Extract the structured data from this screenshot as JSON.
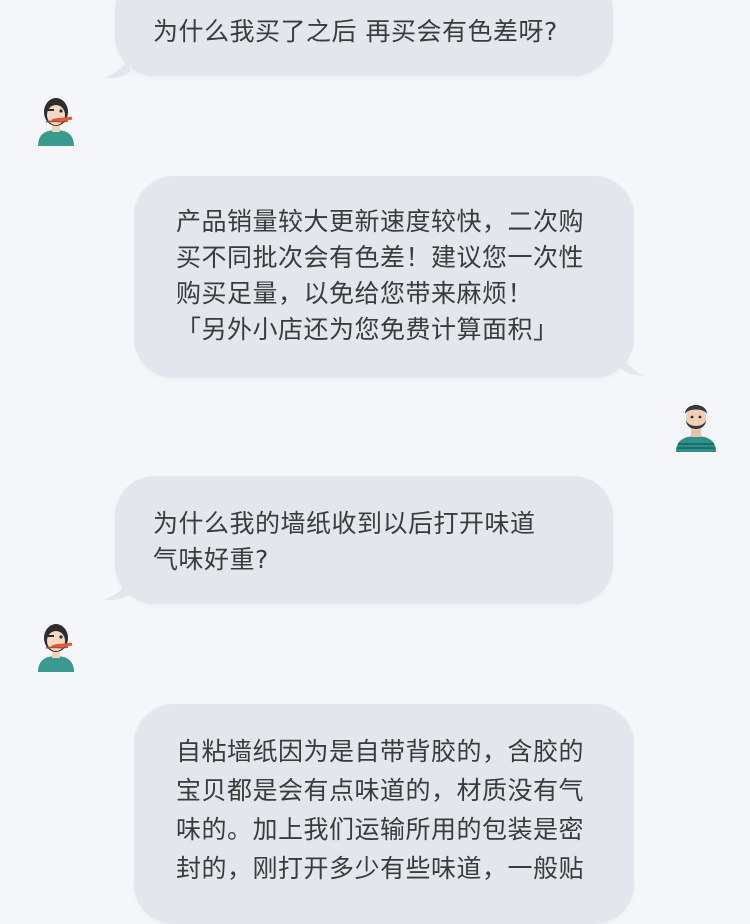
{
  "messages": [
    {
      "role": "customer",
      "lines": [
        "为什么我买了之后 再买会有色差呀?"
      ]
    },
    {
      "role": "seller",
      "lines": [
        "产品销量较大更新速度较快，二次购",
        "买不同批次会有色差！建议您一次性",
        "购买足量，以免给您带来麻烦！",
        "「另外小店还为您免费计算面积」"
      ]
    },
    {
      "role": "customer",
      "lines": [
        "为什么我的墙纸收到以后打开味道",
        "气味好重?"
      ]
    },
    {
      "role": "seller",
      "lines": [
        "自粘墙纸因为是自带背胶的，含胶的",
        "宝贝都是会有点味道的，材质没有气",
        "味的。加上我们运输所用的包装是密",
        "封的，刚打开多少有些味道，一般贴"
      ]
    }
  ],
  "colors": {
    "background": "#f4f6f9",
    "bubble": "#e3e7ed",
    "text": "#3b3b3b",
    "customer_shirt": "#3b9a8f",
    "seller_shirt": "#2f8f8a"
  }
}
